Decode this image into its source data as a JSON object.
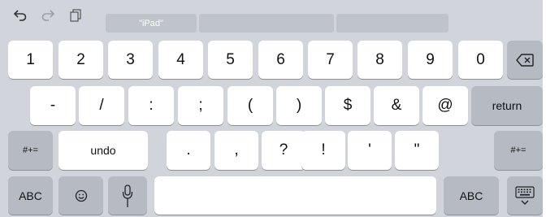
{
  "toolbar": {
    "icons": [
      "undo-icon",
      "redo-icon",
      "paste-icon"
    ],
    "suggestions": [
      "\"iPad\"",
      "",
      ""
    ]
  },
  "rows": {
    "numbers": [
      "1",
      "2",
      "3",
      "4",
      "5",
      "6",
      "7",
      "8",
      "9",
      "0"
    ],
    "delete_icon": "backspace-icon",
    "symbols": [
      "-",
      "/",
      ":",
      ";",
      "(",
      ")",
      "$",
      "&",
      "@"
    ],
    "return_label": "return",
    "shift_left_label": "#+=",
    "undo_label": "undo",
    "punct": [
      ".",
      ",",
      "?",
      "!",
      "'",
      "\""
    ],
    "shift_right_label": "#+="
  },
  "bottom": {
    "abc_left_label": "ABC",
    "emoji_icon": "emoji-icon",
    "mic_icon": "microphone-icon",
    "space_label": "",
    "abc_right_label": "ABC",
    "hide_keyboard_icon": "keyboard-hide-icon"
  },
  "colors": {
    "keyboard_bg": "#d1d4da",
    "key_light": "#ffffff",
    "key_dark": "#b6bbc3",
    "suggestion_bg": "#bfc3ca"
  }
}
